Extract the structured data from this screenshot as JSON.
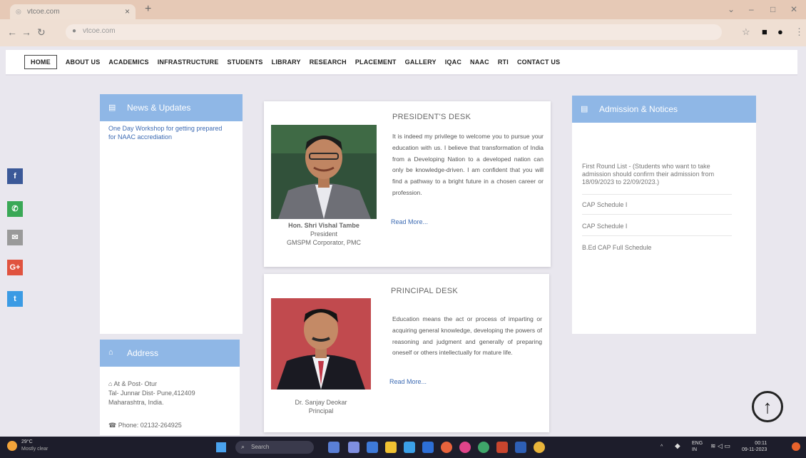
{
  "browser": {
    "tab_title": "vtcoe.com",
    "url": "vtcoe.com",
    "new_tab": "+",
    "close": "×"
  },
  "menu": [
    "HOME",
    "ABOUT US",
    "ACADEMICS",
    "INFRASTRUCTURE",
    "STUDENTS",
    "LIBRARY",
    "RESEARCH",
    "PLACEMENT",
    "GALLERY",
    "IQAC",
    "NAAC",
    "RTI",
    "CONTACT US"
  ],
  "social": [
    {
      "icon": "facebook-icon",
      "glyph": "f",
      "color": "#3b5998"
    },
    {
      "icon": "whatsapp-icon",
      "glyph": "✆",
      "color": "#3aa856"
    },
    {
      "icon": "email-icon",
      "glyph": "✉",
      "color": "#9a9a9a"
    },
    {
      "icon": "google-plus-icon",
      "glyph": "G+",
      "color": "#e0533f"
    },
    {
      "icon": "twitter-icon",
      "glyph": "t",
      "color": "#3b9be4"
    }
  ],
  "news": {
    "title": "News & Updates",
    "items": [
      "One Day Workshop for getting prepared for NAAC accrediation"
    ]
  },
  "address": {
    "title": "Address",
    "line1": "At & Post- Otur",
    "line2": "Tal- Junnar Dist- Pune,412409",
    "line3": "Maharashtra, India.",
    "phone": "Phone: 02132-264925"
  },
  "president": {
    "heading": "PRESIDENT'S DESK",
    "text": "It is indeed my privilege to welcome you to pursue your education with us. I believe that transformation of India from a Developing Nation to a developed nation can only be knowledge-driven. I am confident that you will find a pathway to a bright future in a chosen career or profession.",
    "read_more": "Read More...",
    "name": "Hon. Shri Vishal Tambe",
    "role": "President",
    "org": "GMSPM Corporator, PMC"
  },
  "principal": {
    "heading": "PRINCIPAL DESK",
    "text": "Education means the act or process of imparting or acquiring general knowledge, developing the powers of reasoning and judgment and generally of preparing oneself or others intellectually for mature life.",
    "read_more": "Read More...",
    "name": "Dr. Sanjay Deokar",
    "role": "Principal"
  },
  "notices": {
    "title": "Admission & Notices",
    "items": [
      "First Round List - (Students who want to take admission should confirm their admission from 18/09/2023 to 22/09/2023.)",
      "CAP Schedule I",
      "CAP Schedule I",
      "B.Ed CAP Full Schedule"
    ]
  },
  "taskbar": {
    "temp": "29°C",
    "condition": "Mostly clear",
    "search": "Search",
    "lang": "ENG",
    "region": "IN",
    "time": "00:11",
    "date": "09-11-2023"
  }
}
